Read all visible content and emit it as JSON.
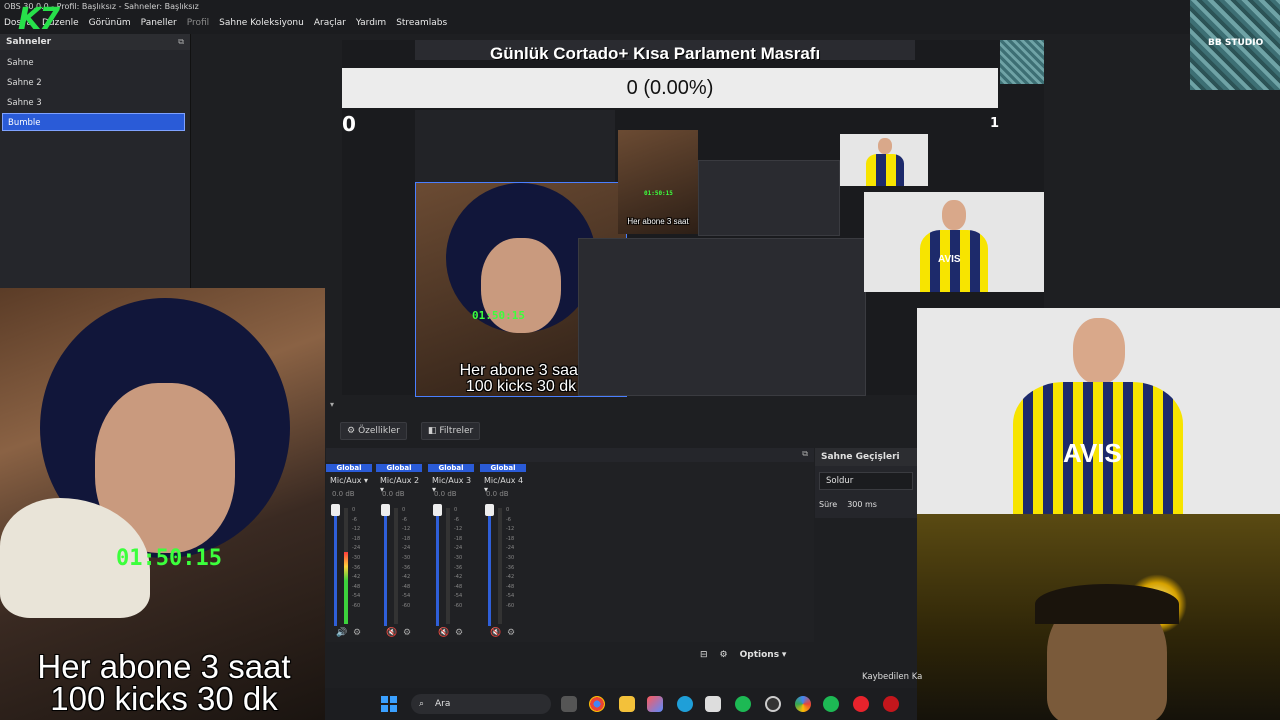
{
  "window": {
    "title": "OBS 30.0.0 - Profil: Başlıksız - Sahneler: Başlıksız",
    "menu": [
      "Dosya",
      "Düzenle",
      "Görünüm",
      "Paneller",
      "Profil",
      "Sahne Koleksiyonu",
      "Araçlar",
      "Yardım",
      "Streamlabs"
    ],
    "logo": "K7"
  },
  "scenes": {
    "header": "Sahneler",
    "items": [
      "Sahne",
      "Sahne 2",
      "Sahne 3",
      "Bumble"
    ],
    "active_index": 3
  },
  "overlay": {
    "timer": "01:50:15",
    "line1": "Her abone 3 saat",
    "line2": "100 kicks 30 dk"
  },
  "goal": {
    "title": "Günlük Cortado+ Kısa Parlament Masrafı",
    "progress_text": "0 (0.00%)",
    "min": "0",
    "max": "1",
    "progress": 0.0
  },
  "tabs": {
    "properties": "Özellikler",
    "filters": "Filtreler"
  },
  "mixer": {
    "channels": [
      {
        "global": "Global",
        "name": "Mic/Aux",
        "db": "0.0 dB",
        "level": 0.62
      },
      {
        "global": "Global",
        "name": "Mic/Aux 2",
        "db": "0.0 dB",
        "level": 0.0
      },
      {
        "global": "Global",
        "name": "Mic/Aux 3",
        "db": "0.0 dB",
        "level": 0.0
      },
      {
        "global": "Global",
        "name": "Mic/Aux 4",
        "db": "0.0 dB",
        "level": 0.0
      }
    ],
    "ticks": [
      "0",
      "-6",
      "-12",
      "-18",
      "-24",
      "-30",
      "-36",
      "-42",
      "-48",
      "-54",
      "-60"
    ]
  },
  "toolbar": {
    "options": "Options"
  },
  "transitions": {
    "header": "Sahne Geçişleri",
    "type": "Soldur",
    "duration_label": "Süre",
    "duration_value": "300 ms"
  },
  "brand": {
    "studio": "BB STUDIO",
    "sponsor": "AVIS"
  },
  "taskbar": {
    "search": "Ara",
    "notice": "Kaybedilen Ka"
  },
  "colors": {
    "accent": "#2a5bd7",
    "timer": "#3cff3c",
    "panel": "#25262b"
  }
}
